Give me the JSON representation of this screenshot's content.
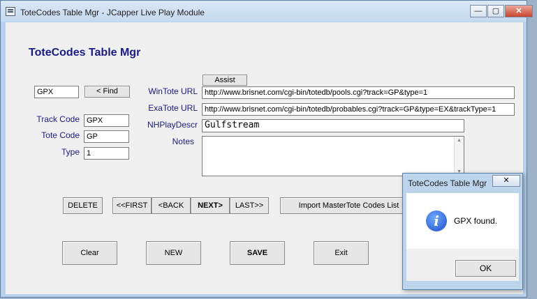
{
  "window": {
    "title": "ToteCodes Table Mgr - JCapper Live Play Module",
    "minimize": "—",
    "maximize": "▢",
    "close": "✕"
  },
  "heading": "ToteCodes Table Mgr",
  "find": {
    "value": "GPX",
    "button": "< Find"
  },
  "fields": {
    "track_code_label": "Track Code",
    "track_code": "GPX",
    "tote_code_label": "Tote Code",
    "tote_code": "GP",
    "type_label": "Type",
    "type": "1"
  },
  "assist_button": "Assist",
  "urls": {
    "wintote_label": "WinTote URL",
    "wintote": "http://www.brisnet.com/cgi-bin/totedb/pools.cgi?track=GP&type=1",
    "exatote_label": "ExaTote URL",
    "exatote": "http://www.brisnet.com/cgi-bin/totedb/probables.cgi?track=GP&type=EX&trackType=1",
    "nhplay_label": "NHPlayDescr",
    "nhplay": "Gulfstream",
    "notes_label": "Notes",
    "notes": ""
  },
  "nav": {
    "delete": "DELETE",
    "first": "<<FIRST",
    "back": "<BACK",
    "next": "NEXT>",
    "last": "LAST>>",
    "import": "Import MasterTote Codes List"
  },
  "actions": {
    "clear": "Clear",
    "new": "NEW",
    "save": "SAVE",
    "exit": "Exit"
  },
  "dialog": {
    "title": "ToteCodes Table Mgr",
    "close": "✕",
    "icon": "i",
    "message": "GPX found.",
    "ok": "OK"
  }
}
